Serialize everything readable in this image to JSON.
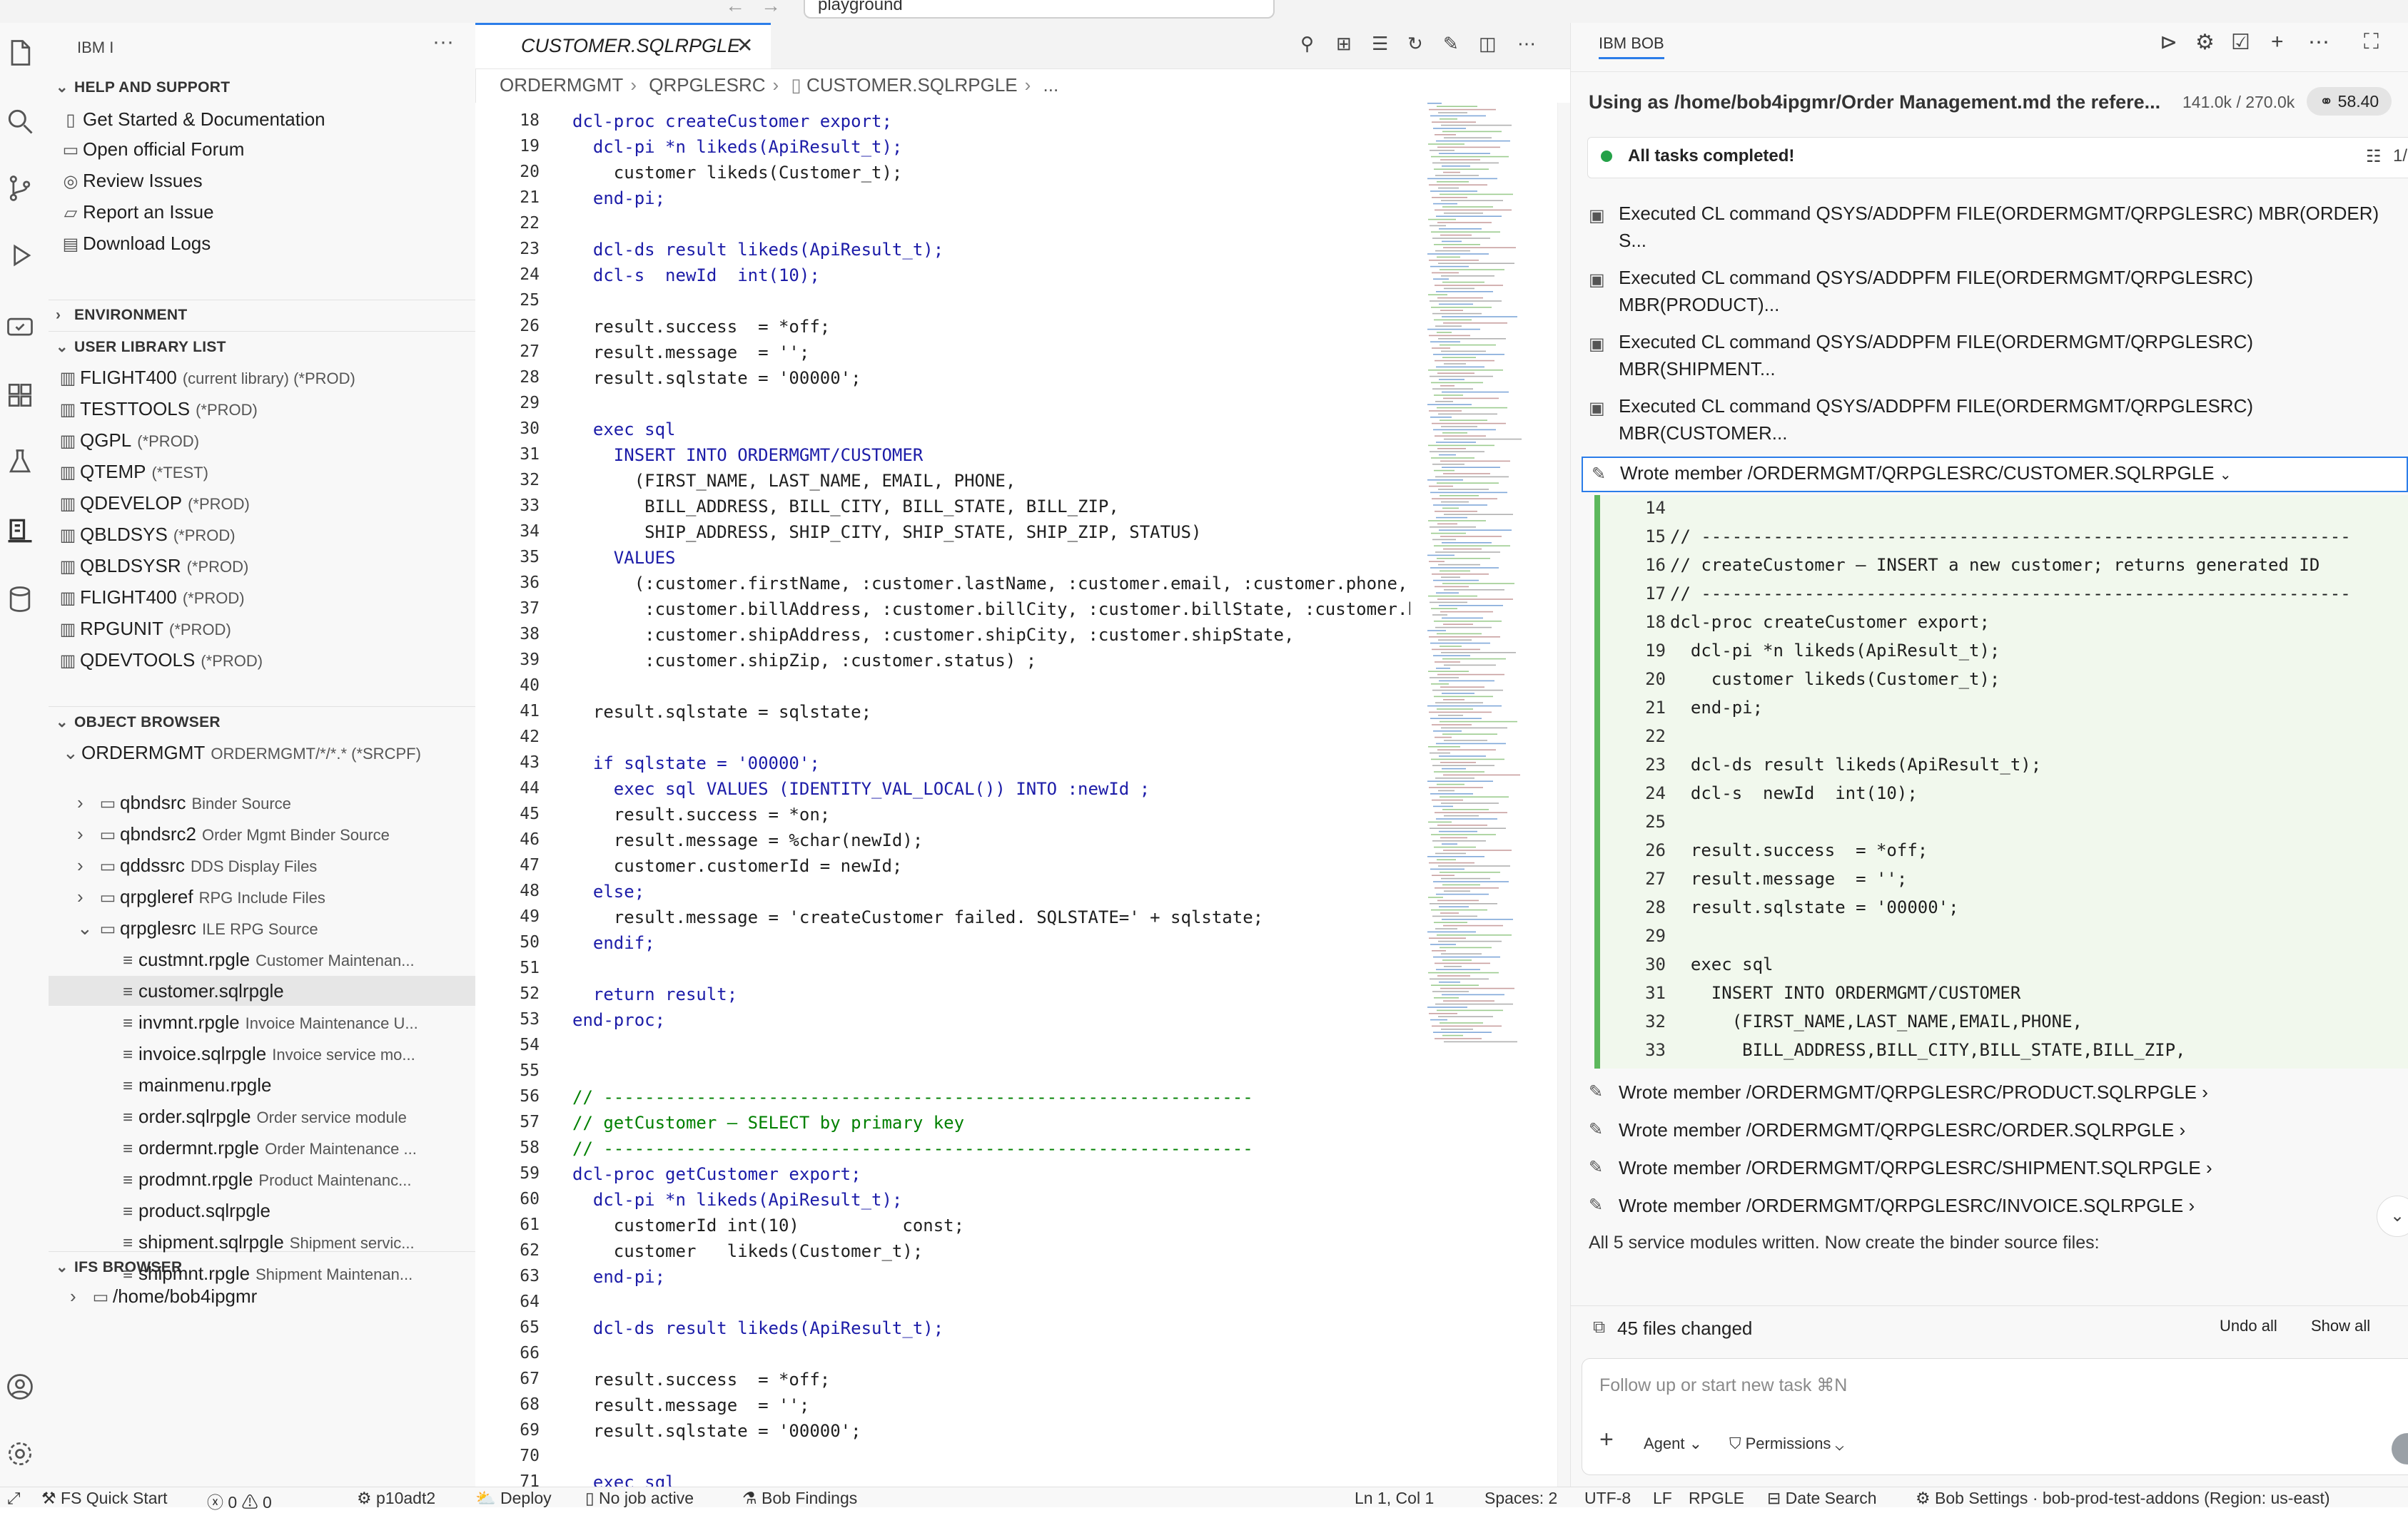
{
  "top": {
    "search_text": "playground",
    "nav_back": "←",
    "nav_forward": "→"
  },
  "activity_bar": {
    "icons": [
      "files-icon",
      "search-icon",
      "source-control-icon",
      "run-debug-icon",
      "remote-icon",
      "extensions-icon",
      "testing-icon",
      "ibmi-icon",
      "database-icon",
      "account-icon",
      "settings-icon"
    ]
  },
  "sidebar": {
    "title": "IBM I",
    "more": "···",
    "help_section": "HELP AND SUPPORT",
    "help_items": [
      "Get Started & Documentation",
      "Open official Forum",
      "Review Issues",
      "Report an Issue",
      "Download Logs"
    ],
    "environment_section": "ENVIRONMENT",
    "library_section": "USER LIBRARY LIST",
    "libraries": [
      {
        "name": "FLIGHT400",
        "desc": "(current library) (*PROD)"
      },
      {
        "name": "TESTTOOLS",
        "desc": "(*PROD)"
      },
      {
        "name": "QGPL",
        "desc": "(*PROD)"
      },
      {
        "name": "QTEMP",
        "desc": "(*TEST)"
      },
      {
        "name": "QDEVELOP",
        "desc": "(*PROD)"
      },
      {
        "name": "QBLDSYS",
        "desc": "(*PROD)"
      },
      {
        "name": "QBLDSYSR",
        "desc": "(*PROD)"
      },
      {
        "name": "FLIGHT400",
        "desc": "(*PROD)"
      },
      {
        "name": "RPGUNIT",
        "desc": "(*PROD)"
      },
      {
        "name": "QDEVTOOLS",
        "desc": "(*PROD)"
      }
    ],
    "object_section": "OBJECT BROWSER",
    "filter": {
      "name": "ORDERMGMT",
      "desc": "ORDERMGMT/*/*.* (*SRCPF)"
    },
    "source_files": [
      {
        "name": "qbndsrc",
        "desc": "Binder Source"
      },
      {
        "name": "qbndsrc2",
        "desc": "Order Mgmt Binder Source"
      },
      {
        "name": "qddssrc",
        "desc": "DDS Display Files"
      },
      {
        "name": "qrpgleref",
        "desc": "RPG Include Files"
      },
      {
        "name": "qrpglesrc",
        "desc": "ILE RPG Source"
      }
    ],
    "members": [
      {
        "name": "custmnt.rpgle",
        "desc": "Customer Maintenan..."
      },
      {
        "name": "customer.sqlrpgle",
        "desc": ""
      },
      {
        "name": "invmnt.rpgle",
        "desc": "Invoice Maintenance U..."
      },
      {
        "name": "invoice.sqlrpgle",
        "desc": "Invoice service mo..."
      },
      {
        "name": "mainmenu.rpgle",
        "desc": ""
      },
      {
        "name": "order.sqlrpgle",
        "desc": "Order service module"
      },
      {
        "name": "ordermnt.rpgle",
        "desc": "Order Maintenance ..."
      },
      {
        "name": "prodmnt.rpgle",
        "desc": "Product Maintenanc..."
      },
      {
        "name": "product.sqlrpgle",
        "desc": ""
      },
      {
        "name": "shipment.sqlrpgle",
        "desc": "Shipment servic..."
      },
      {
        "name": "shipmnt.rpgle",
        "desc": "Shipment Maintenan..."
      }
    ],
    "ifs_section": "IFS BROWSER",
    "ifs_path": "/home/bob4ipgmr"
  },
  "editor": {
    "tab_label": "CUSTOMER.SQLRPGLE",
    "tab_close": "✕",
    "breadcrumb": [
      "ORDERMGMT",
      "QRPGLESRC",
      "CUSTOMER.SQLRPGLE",
      "..."
    ],
    "lines": [
      {
        "n": "18",
        "t": "dcl-proc createCustomer export;"
      },
      {
        "n": "19",
        "t": "  dcl-pi *n likeds(ApiResult_t);"
      },
      {
        "n": "20",
        "t": "    customer likeds(Customer_t);"
      },
      {
        "n": "21",
        "t": "  end-pi;"
      },
      {
        "n": "22",
        "t": ""
      },
      {
        "n": "23",
        "t": "  dcl-ds result likeds(ApiResult_t);"
      },
      {
        "n": "24",
        "t": "  dcl-s  newId  int(10);"
      },
      {
        "n": "25",
        "t": ""
      },
      {
        "n": "26",
        "t": "  result.success  = *off;"
      },
      {
        "n": "27",
        "t": "  result.message  = '';"
      },
      {
        "n": "28",
        "t": "  result.sqlstate = '00000';"
      },
      {
        "n": "29",
        "t": ""
      },
      {
        "n": "30",
        "t": "  exec sql"
      },
      {
        "n": "31",
        "t": "    INSERT INTO ORDERMGMT/CUSTOMER"
      },
      {
        "n": "32",
        "t": "      (FIRST_NAME, LAST_NAME, EMAIL, PHONE,"
      },
      {
        "n": "33",
        "t": "       BILL_ADDRESS, BILL_CITY, BILL_STATE, BILL_ZIP,"
      },
      {
        "n": "34",
        "t": "       SHIP_ADDRESS, SHIP_CITY, SHIP_STATE, SHIP_ZIP, STATUS)"
      },
      {
        "n": "35",
        "t": "    VALUES"
      },
      {
        "n": "36",
        "t": "      (:customer.firstName, :customer.lastName, :customer.email, :customer.phone,"
      },
      {
        "n": "37",
        "t": "       :customer.billAddress, :customer.billCity, :customer.billState, :customer.b"
      },
      {
        "n": "38",
        "t": "       :customer.shipAddress, :customer.shipCity, :customer.shipState,"
      },
      {
        "n": "39",
        "t": "       :customer.shipZip, :customer.status) ;"
      },
      {
        "n": "40",
        "t": ""
      },
      {
        "n": "41",
        "t": "  result.sqlstate = sqlstate;"
      },
      {
        "n": "42",
        "t": ""
      },
      {
        "n": "43",
        "t": "  if sqlstate = '00000';"
      },
      {
        "n": "44",
        "t": "    exec sql VALUES (IDENTITY_VAL_LOCAL()) INTO :newId ;"
      },
      {
        "n": "45",
        "t": "    result.success = *on;"
      },
      {
        "n": "46",
        "t": "    result.message = %char(newId);"
      },
      {
        "n": "47",
        "t": "    customer.customerId = newId;"
      },
      {
        "n": "48",
        "t": "  else;"
      },
      {
        "n": "49",
        "t": "    result.message = 'createCustomer failed. SQLSTATE=' + sqlstate;"
      },
      {
        "n": "50",
        "t": "  endif;"
      },
      {
        "n": "51",
        "t": ""
      },
      {
        "n": "52",
        "t": "  return result;"
      },
      {
        "n": "53",
        "t": "end-proc;"
      },
      {
        "n": "54",
        "t": ""
      },
      {
        "n": "55",
        "t": ""
      },
      {
        "n": "56",
        "t": "// ---------------------------------------------------------------"
      },
      {
        "n": "57",
        "t": "// getCustomer — SELECT by primary key"
      },
      {
        "n": "58",
        "t": "// ---------------------------------------------------------------"
      },
      {
        "n": "59",
        "t": "dcl-proc getCustomer export;"
      },
      {
        "n": "60",
        "t": "  dcl-pi *n likeds(ApiResult_t);"
      },
      {
        "n": "61",
        "t": "    customerId int(10)          const;"
      },
      {
        "n": "62",
        "t": "    customer   likeds(Customer_t);"
      },
      {
        "n": "63",
        "t": "  end-pi;"
      },
      {
        "n": "64",
        "t": ""
      },
      {
        "n": "65",
        "t": "  dcl-ds result likeds(ApiResult_t);"
      },
      {
        "n": "66",
        "t": ""
      },
      {
        "n": "67",
        "t": "  result.success  = *off;"
      },
      {
        "n": "68",
        "t": "  result.message  = '';"
      },
      {
        "n": "69",
        "t": "  result.sqlstate = '00000';"
      },
      {
        "n": "70",
        "t": ""
      },
      {
        "n": "71",
        "t": "  exec sql"
      }
    ]
  },
  "panel": {
    "tab": "IBM BOB",
    "context": "Using as /home/bob4ipgmr/Order Management.md the refere...",
    "tokens": "141.0k / 270.0k",
    "cost": "58.40",
    "tasks_status": "All tasks completed!",
    "tasks_counter": "1/",
    "executed": [
      "Executed CL command QSYS/ADDPFM FILE(ORDERMGMT/QRPGLESRC) MBR(ORDER) S...",
      "Executed CL command QSYS/ADDPFM FILE(ORDERMGMT/QRPGLESRC) MBR(PRODUCT)...",
      "Executed CL command QSYS/ADDPFM FILE(ORDERMGMT/QRPGLESRC) MBR(SHIPMENT...",
      "Executed CL command QSYS/ADDPFM FILE(ORDERMGMT/QRPGLESRC) MBR(CUSTOMER..."
    ],
    "wrote_active": "Wrote member /ORDERMGMT/QRPGLESRC/CUSTOMER.SQLRPGLE",
    "diff_lines": [
      {
        "n": "14",
        "t": ""
      },
      {
        "n": "15",
        "t": "// ---------------------------------------------------------------"
      },
      {
        "n": "16",
        "t": "// createCustomer — INSERT a new customer; returns generated ID"
      },
      {
        "n": "17",
        "t": "// ---------------------------------------------------------------"
      },
      {
        "n": "18",
        "t": "dcl-proc createCustomer export;"
      },
      {
        "n": "19",
        "t": "  dcl-pi *n likeds(ApiResult_t);"
      },
      {
        "n": "20",
        "t": "    customer likeds(Customer_t);"
      },
      {
        "n": "21",
        "t": "  end-pi;"
      },
      {
        "n": "22",
        "t": ""
      },
      {
        "n": "23",
        "t": "  dcl-ds result likeds(ApiResult_t);"
      },
      {
        "n": "24",
        "t": "  dcl-s  newId  int(10);"
      },
      {
        "n": "25",
        "t": ""
      },
      {
        "n": "26",
        "t": "  result.success  = *off;"
      },
      {
        "n": "27",
        "t": "  result.message  = '';"
      },
      {
        "n": "28",
        "t": "  result.sqlstate = '00000';"
      },
      {
        "n": "29",
        "t": ""
      },
      {
        "n": "30",
        "t": "  exec sql"
      },
      {
        "n": "31",
        "t": "    INSERT INTO ORDERMGMT/CUSTOMER"
      },
      {
        "n": "32",
        "t": "      (FIRST_NAME,LAST_NAME,EMAIL,PHONE,"
      },
      {
        "n": "33",
        "t": "       BILL_ADDRESS,BILL_CITY,BILL_STATE,BILL_ZIP,"
      }
    ],
    "wrote_others": [
      "Wrote member /ORDERMGMT/QRPGLESRC/PRODUCT.SQLRPGLE",
      "Wrote member /ORDERMGMT/QRPGLESRC/ORDER.SQLRPGLE",
      "Wrote member /ORDERMGMT/QRPGLESRC/SHIPMENT.SQLRPGLE",
      "Wrote member /ORDERMGMT/QRPGLESRC/INVOICE.SQLRPGLE"
    ],
    "message": "All 5 service modules written. Now create the binder source files:",
    "files_changed": "45 files changed",
    "undo_all": "Undo all",
    "show_all": "Show all",
    "input_placeholder": "Follow up or start new task ⌘N",
    "agent": "Agent",
    "permissions": "Permissions"
  },
  "status": {
    "quick_start": "FS Quick Start",
    "problems": "0",
    "warnings": "0",
    "connection": "p10adt2",
    "deploy": "Deploy",
    "job": "No job active",
    "findings": "Bob Findings",
    "position": "Ln 1, Col 1",
    "spaces": "Spaces: 2",
    "encoding": "UTF-8",
    "eol": "LF",
    "language": "RPGLE",
    "date_search": "Date Search",
    "settings": "Bob Settings · bob-prod-test-addons (Region: us-east)"
  },
  "colors": {
    "accent": "#2b7de9",
    "keyword": "#0000ff",
    "string": "#a31515",
    "comment": "#008000",
    "added": "#f1f8ed",
    "added_bar": "#5cb85c",
    "success": "#24a148"
  }
}
